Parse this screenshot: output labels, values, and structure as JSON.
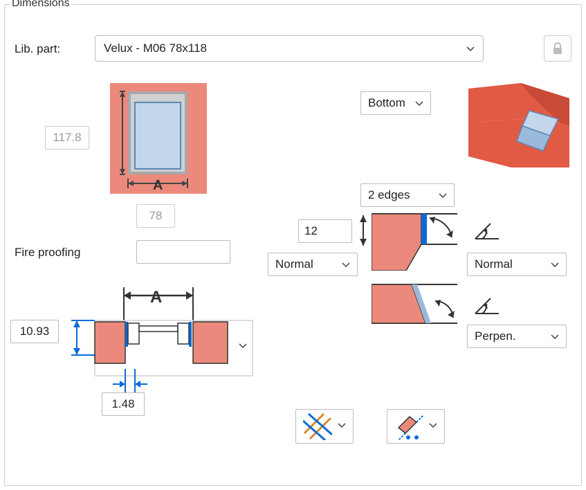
{
  "group_title": "Dimensions",
  "lib_part_label": "Lib. part:",
  "lib_part_value": "Velux - M06 78x118",
  "height_value": "117.8",
  "width_value": "78",
  "fire_proofing_label": "Fire proofing",
  "fire_proofing_value": "",
  "reveal_depth_value": "10.93",
  "wall_gap_value": "1.48",
  "anchor_value": "Bottom",
  "edges_value": "2 edges",
  "edge_offset_value": "12",
  "top_cut_value": "Normal",
  "top_angle_value": "Normal",
  "bottom_angle_value": "Perpen."
}
